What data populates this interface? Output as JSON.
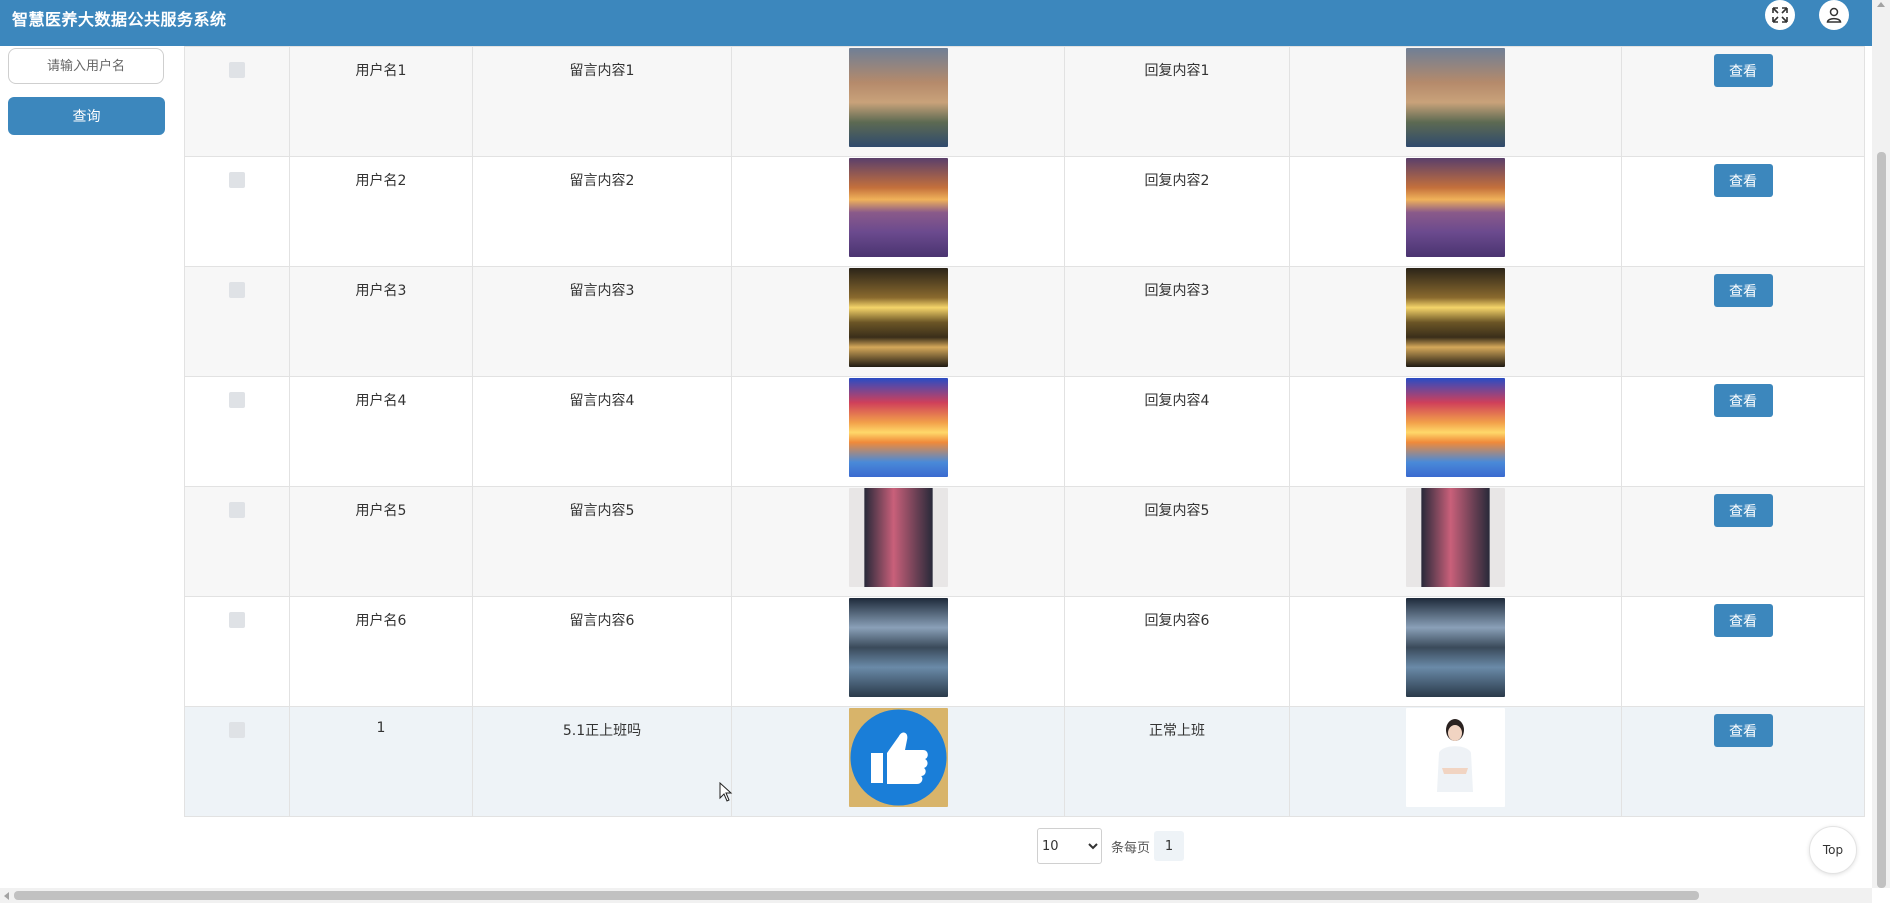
{
  "header": {
    "title": "智慧医养大数据公共服务系统",
    "icons": [
      "fullscreen-icon",
      "user-icon"
    ]
  },
  "sidebar": {
    "search_placeholder": "请输入用户名",
    "query_label": "查询"
  },
  "table": {
    "view_label": "查看",
    "rows": [
      {
        "username": "用户名1",
        "message": "留言内容1",
        "reply": "回复内容1",
        "image": "coastal-village-photo",
        "reply_image": "coastal-village-photo"
      },
      {
        "username": "用户名2",
        "message": "留言内容2",
        "reply": "回复内容2",
        "image": "lavender-field-sunset-photo",
        "reply_image": "lavender-field-sunset-photo"
      },
      {
        "username": "用户名3",
        "message": "留言内容3",
        "reply": "回复内容3",
        "image": "beach-sunset-photo",
        "reply_image": "beach-sunset-photo"
      },
      {
        "username": "用户名4",
        "message": "留言内容4",
        "reply": "回复内容4",
        "image": "dolphin-sunset-photo",
        "reply_image": "dolphin-sunset-photo"
      },
      {
        "username": "用户名5",
        "message": "留言内容5",
        "reply": "回复内容5",
        "image": "framed-cloud-art-photo",
        "reply_image": "framed-cloud-art-photo"
      },
      {
        "username": "用户名6",
        "message": "留言内容6",
        "reply": "回复内容6",
        "image": "mountain-river-photo",
        "reply_image": "mountain-river-photo"
      },
      {
        "username": "1",
        "message": "5.1正上班吗",
        "reply": "正常上班",
        "image": "thumbs-up-image",
        "reply_image": "nurse-photo"
      }
    ]
  },
  "pagination": {
    "page_size": "10",
    "per_page_label": "条每页",
    "current_page": "1"
  },
  "back_to_top_label": "Top",
  "colors": {
    "primary": "#3c87bd",
    "row_alt": "#f7f7f7",
    "row_highlight": "#eef3f7"
  }
}
